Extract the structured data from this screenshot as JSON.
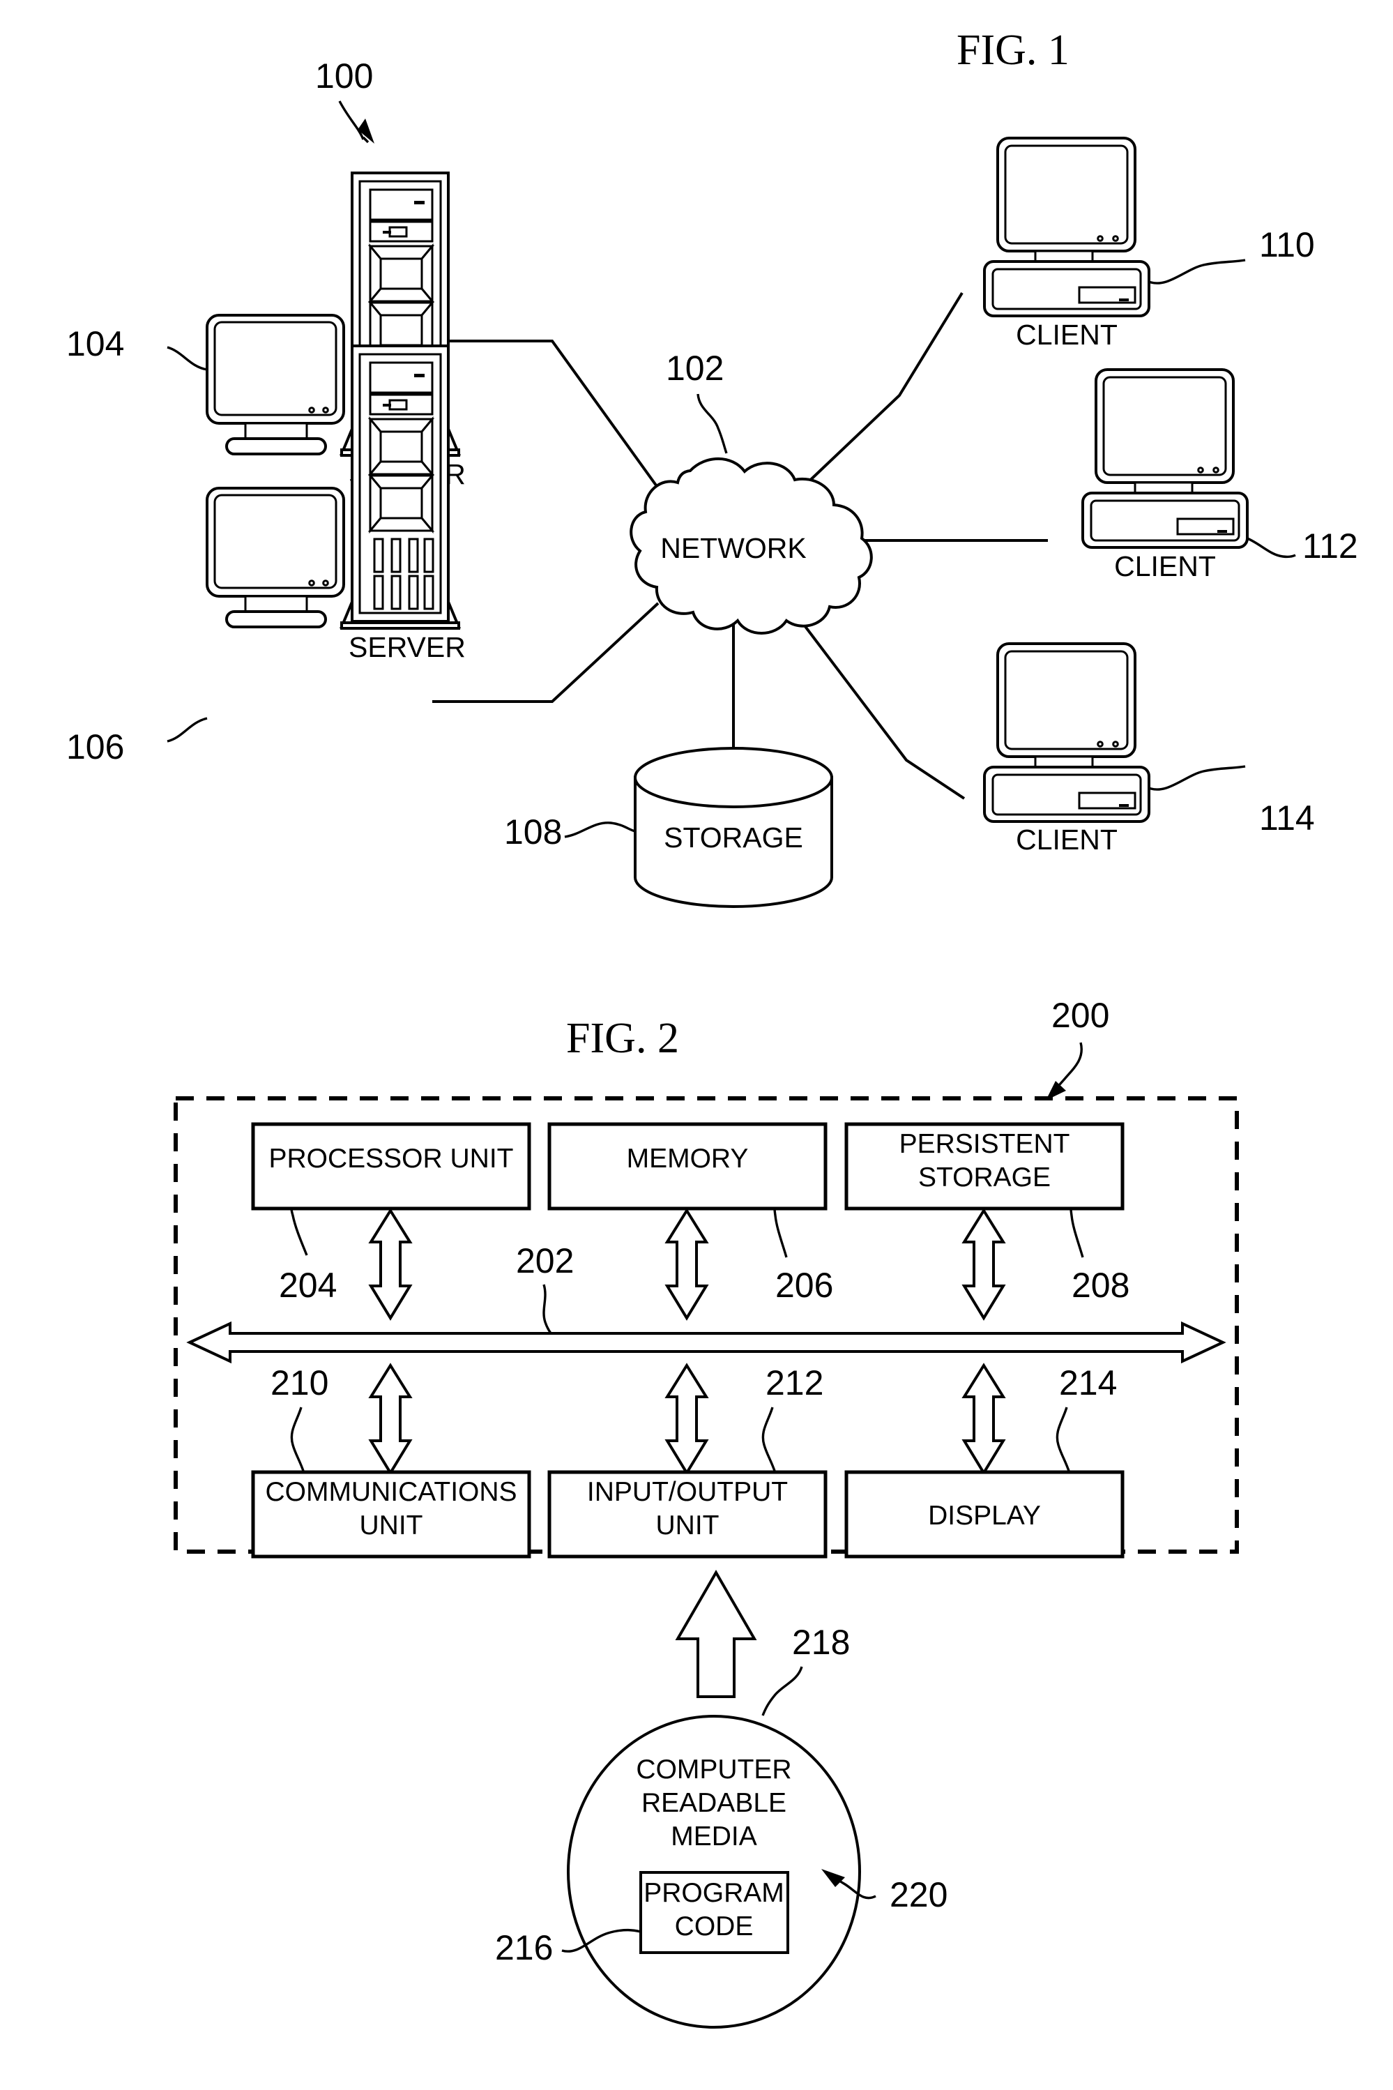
{
  "document": {
    "type": "patent-figure-sheet",
    "figures": [
      {
        "id": "fig1",
        "title": "FIG. 1",
        "system_ref": "100",
        "nodes": [
          {
            "ref": "104",
            "label": "SERVER",
            "kind": "server-with-monitor"
          },
          {
            "ref": "106",
            "label": "SERVER",
            "kind": "server-with-monitor"
          },
          {
            "ref": "102",
            "label": "NETWORK",
            "kind": "cloud"
          },
          {
            "ref": "108",
            "label": "STORAGE",
            "kind": "cylinder"
          },
          {
            "ref": "110",
            "label": "CLIENT",
            "kind": "desktop-computer"
          },
          {
            "ref": "112",
            "label": "CLIENT",
            "kind": "desktop-computer"
          },
          {
            "ref": "114",
            "label": "CLIENT",
            "kind": "desktop-computer"
          }
        ]
      },
      {
        "id": "fig2",
        "title": "FIG. 2",
        "system_ref": "200",
        "data_processing_system": {
          "bus_ref": "202",
          "top_row": [
            {
              "ref": "204",
              "label_line1": "PROCESSOR UNIT",
              "label_line2": ""
            },
            {
              "ref": "206",
              "label_line1": "MEMORY",
              "label_line2": ""
            },
            {
              "ref": "208",
              "label_line1": "PERSISTENT",
              "label_line2": "STORAGE"
            }
          ],
          "bottom_row": [
            {
              "ref": "210",
              "label_line1": "COMMUNICATIONS",
              "label_line2": "UNIT"
            },
            {
              "ref": "212",
              "label_line1": "INPUT/OUTPUT",
              "label_line2": "UNIT"
            },
            {
              "ref": "214",
              "label_line1": "DISPLAY",
              "label_line2": ""
            }
          ]
        },
        "media": {
          "ref": "218",
          "program_product_ref": "220",
          "label_line1": "COMPUTER",
          "label_line2": "READABLE",
          "label_line3": "MEDIA",
          "code_ref": "216",
          "code_line1": "PROGRAM",
          "code_line2": "CODE"
        }
      }
    ]
  },
  "colors": {
    "ink": "#000000",
    "paper": "#ffffff"
  }
}
